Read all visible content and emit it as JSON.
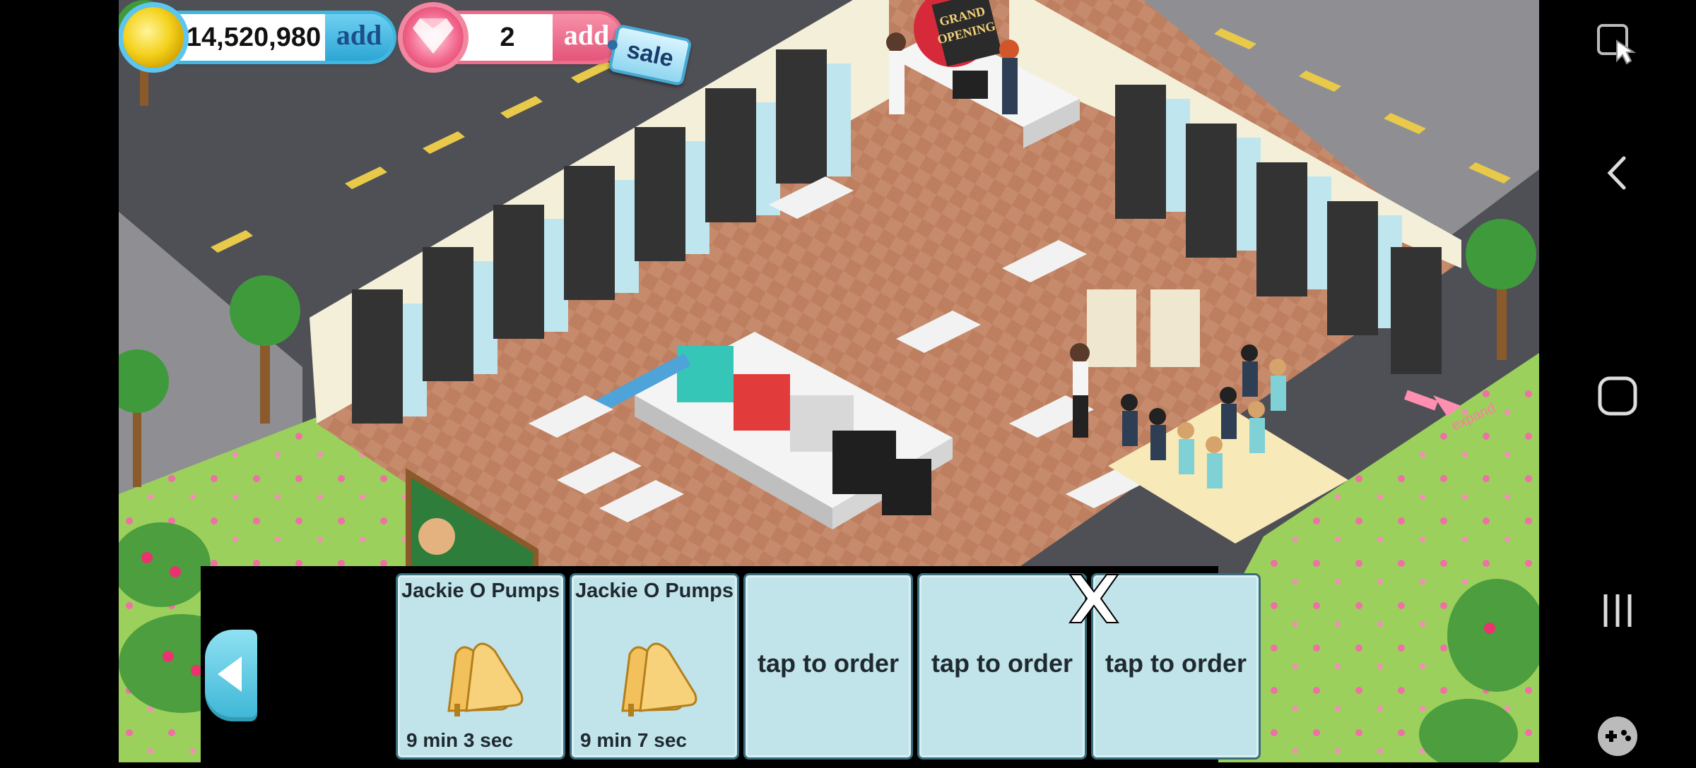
{
  "hud": {
    "coins": "14,520,980",
    "coins_add_label": "add",
    "gems": "2",
    "gems_add_label": "add",
    "sale_label": "sale"
  },
  "scene_labels": {
    "grand_opening": [
      "GRAND",
      "OPENING"
    ],
    "expand": "expand"
  },
  "order_slots": [
    {
      "title": "Jackie O Pumps",
      "timer": "9 min 3 sec",
      "icon": "gold-pumps-icon",
      "state": "in-progress"
    },
    {
      "title": "Jackie O Pumps",
      "timer": "9 min 7 sec",
      "icon": "gold-pumps-icon",
      "state": "in-progress"
    },
    {
      "title": "",
      "tap_label": "tap to order",
      "state": "empty"
    },
    {
      "title": "",
      "tap_label": "tap to order",
      "state": "empty"
    },
    {
      "title": "",
      "tap_label": "tap to order",
      "state": "empty"
    }
  ],
  "order_bar": {
    "close_label": "X"
  },
  "navbar": {
    "buttons": [
      "screenshot-tool-icon",
      "back-icon",
      "home-icon",
      "recent-apps-icon",
      "game-tools-icon"
    ]
  },
  "colors": {
    "coin_accent": "#3fb7e0",
    "gem_accent": "#ef6b8a",
    "slot_bg": "#c1e3ea",
    "floor": "#c98c6a",
    "grass": "#9ccf5a",
    "road": "#505058"
  }
}
